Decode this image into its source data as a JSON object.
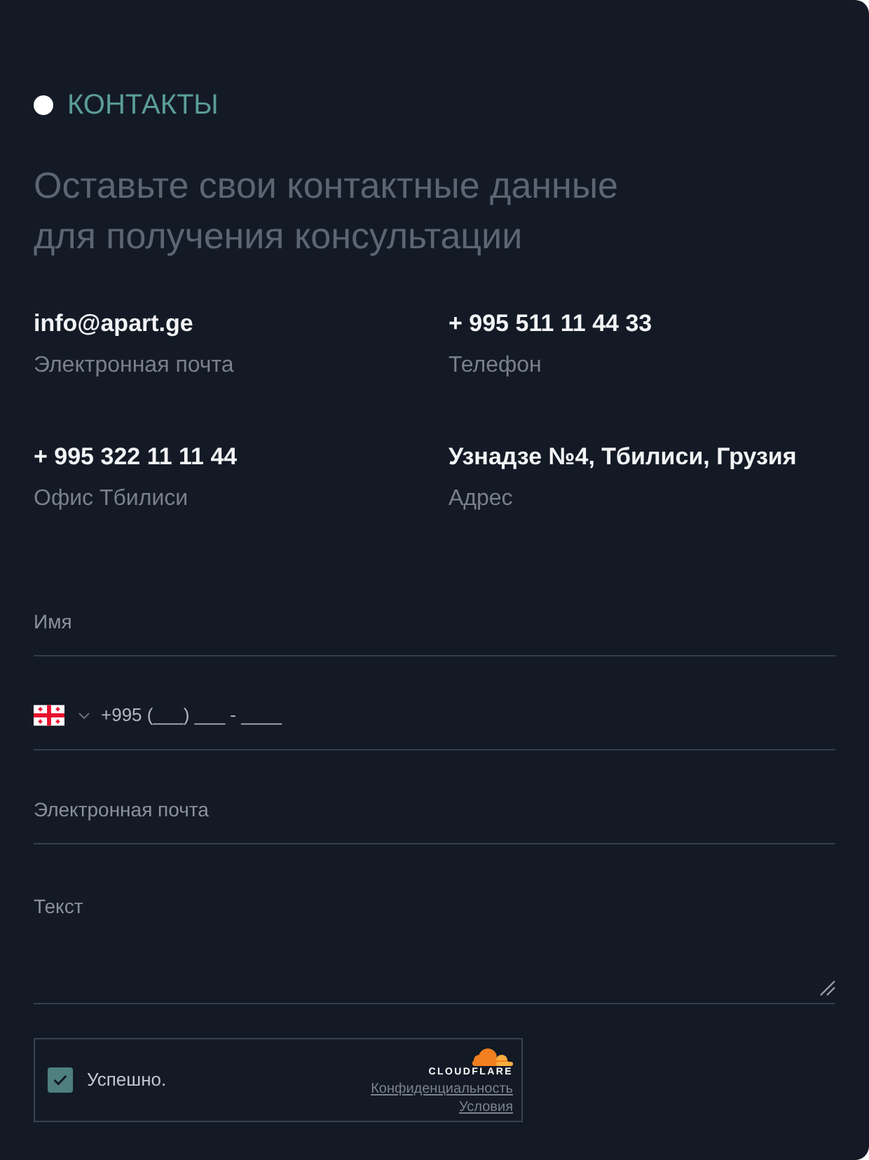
{
  "section": {
    "label": "КОНТАКТЫ"
  },
  "heading": "Оставьте свои контактные данные\nдля получения консультации",
  "contacts": [
    {
      "value": "info@apart.ge",
      "label": "Электронная почта"
    },
    {
      "value": "+ 995 511 11 44 33",
      "label": "Телефон"
    },
    {
      "value": "+ 995 322 11 11 44",
      "label": "Офис Тбилиси"
    },
    {
      "value": "Узнадзе №4, Тбилиси, Грузия",
      "label": "Адрес"
    }
  ],
  "form": {
    "fields": [
      {
        "kind": "text",
        "placeholder": "Имя"
      },
      {
        "kind": "phone",
        "placeholder": "+995 (___) ___ - ____"
      },
      {
        "kind": "text",
        "placeholder": "Электронная почта"
      },
      {
        "kind": "textarea",
        "placeholder": "Текст"
      }
    ]
  },
  "captcha": {
    "checked": true,
    "status": "Успешно.",
    "brand": "CLOUDFLARE",
    "links": [
      "Конфиденциальность",
      "Условия"
    ]
  }
}
